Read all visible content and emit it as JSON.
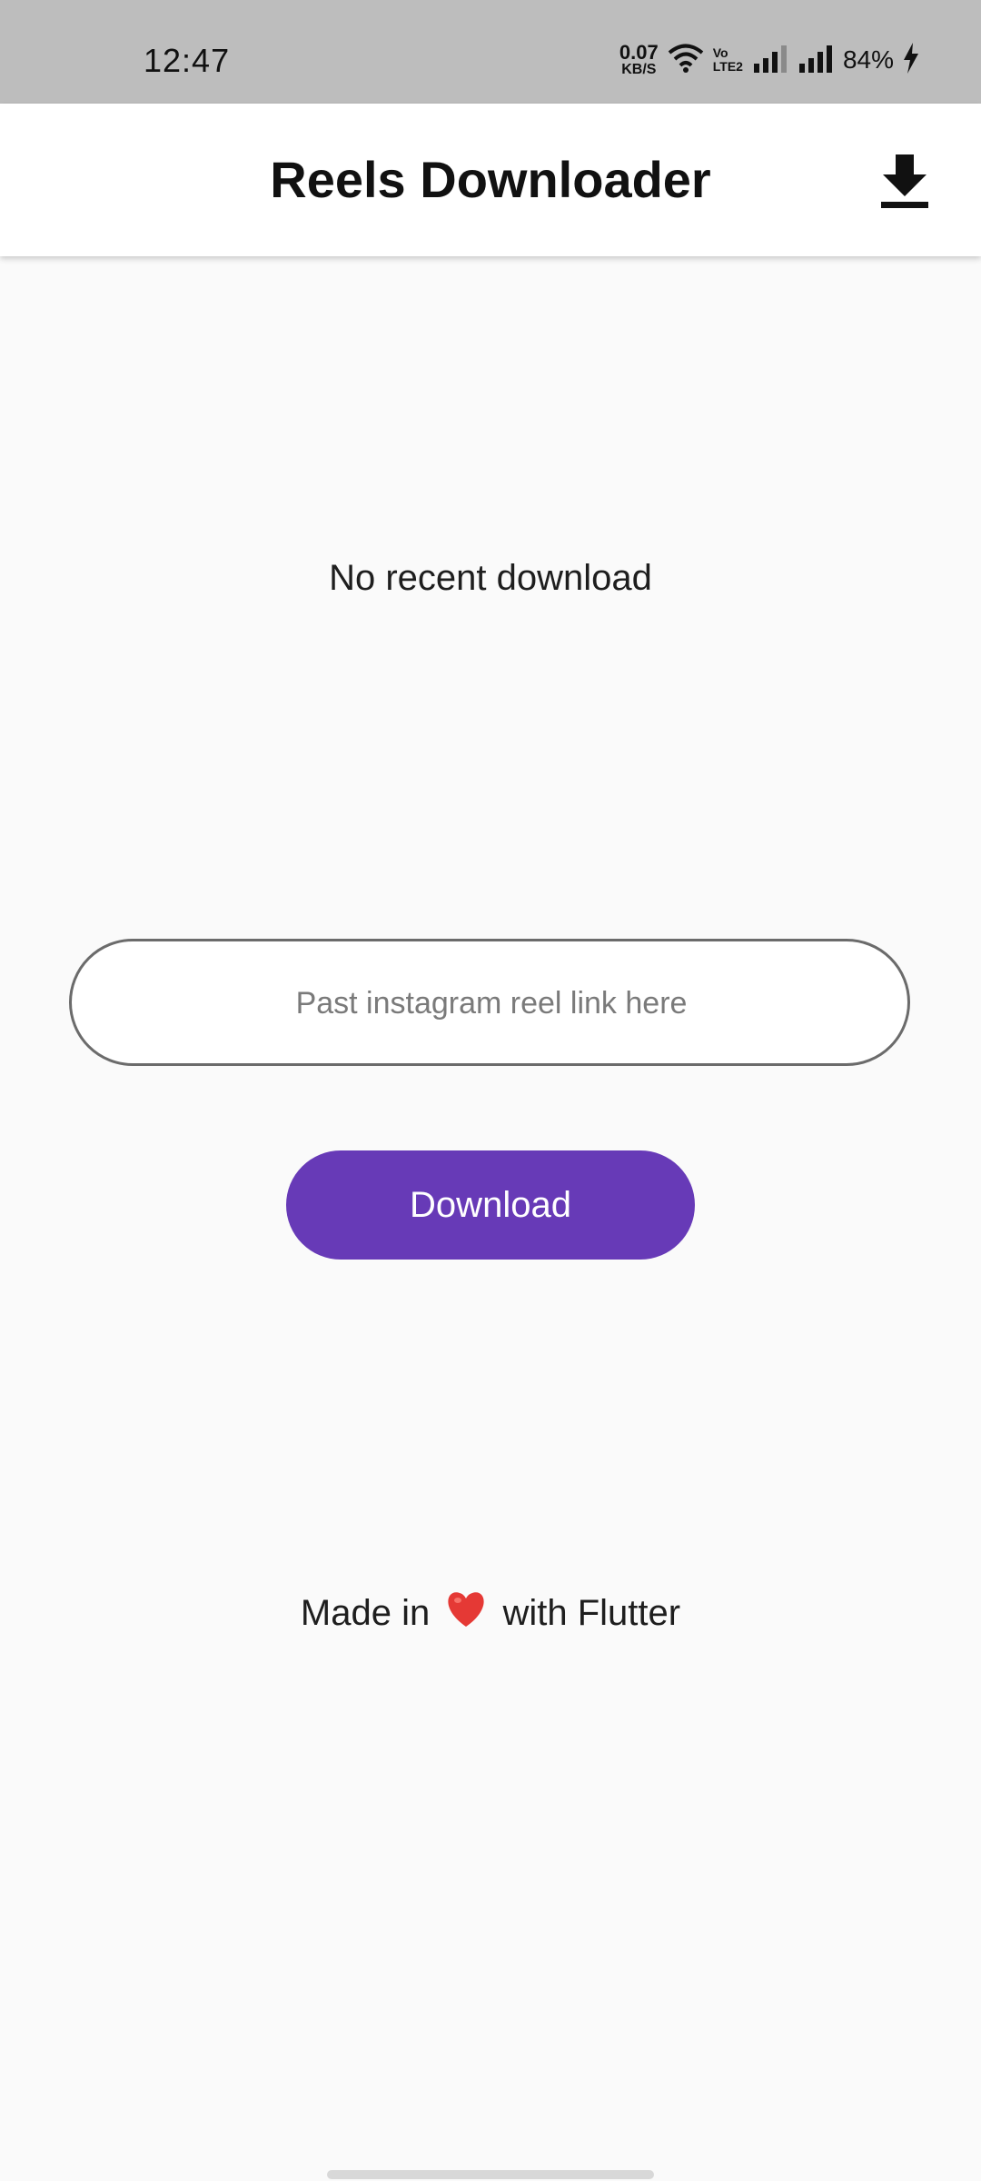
{
  "status_bar": {
    "time": "12:47",
    "net_speed_value": "0.07",
    "net_speed_unit": "KB/S",
    "volte_top": "Vo",
    "volte_bottom": "LTE2",
    "battery": "84%"
  },
  "app_bar": {
    "title": "Reels Downloader",
    "action_icon": "download-icon"
  },
  "main": {
    "recent_status": "No recent download",
    "link_input": {
      "placeholder": "Past instagram reel link here",
      "value": ""
    },
    "download_label": "Download"
  },
  "footer": {
    "prefix": "Made in",
    "suffix": "with Flutter",
    "heart_icon": "heart-icon"
  },
  "colors": {
    "accent": "#673ab7",
    "status_bar_bg": "#bdbdbd",
    "background": "#fafafa"
  }
}
